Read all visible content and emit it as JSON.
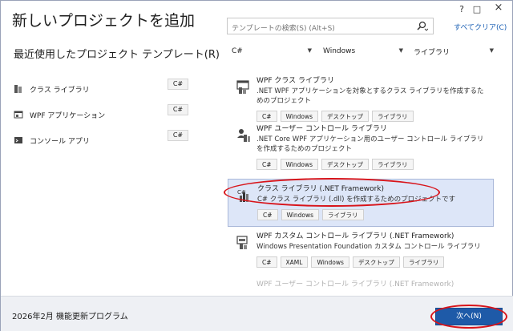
{
  "window": {
    "title": "新しいプロジェクトを追加",
    "help": "?",
    "close": "×",
    "maximize": "□"
  },
  "search": {
    "placeholder": "テンプレートの検索(S) (Alt+S)",
    "clear_all": "すべてクリア(C)"
  },
  "recent": {
    "title": "最近使用したプロジェクト テンプレート(R)",
    "items": [
      {
        "label": "クラス ライブラリ",
        "lang": "C#"
      },
      {
        "label": "WPF アプリケーション",
        "lang": "C#"
      },
      {
        "label": "コンソール アプリ",
        "lang": "C#"
      }
    ]
  },
  "filters": {
    "language": "C#",
    "platform": "Windows",
    "project_type": "ライブラリ"
  },
  "templates": [
    {
      "name": "WPF クラス ライブラリ",
      "desc": ".NET WPF アプリケーションを対象とするクラス ライブラリを作成するためのプロジェクト",
      "tags": [
        "C#",
        "Windows",
        "デスクトップ",
        "ライブラリ"
      ]
    },
    {
      "name": "WPF ユーザー コントロール ライブラリ",
      "desc": ".NET Core WPF アプリケーション用のユーザー コントロール ライブラリを作成するためのプロジェクト",
      "tags": [
        "C#",
        "Windows",
        "デスクトップ",
        "ライブラリ"
      ]
    },
    {
      "name": "クラス ライブラリ (.NET Framework)",
      "desc": "C# クラス ライブラリ (.dll) を作成するためのプロジェクトです",
      "tags": [
        "C#",
        "Windows",
        "ライブラリ"
      ]
    },
    {
      "name": "WPF カスタム コントロール ライブラリ (.NET Framework)",
      "desc": "Windows Presentation Foundation カスタム コントロール ライブラリ",
      "tags": [
        "C#",
        "XAML",
        "Windows",
        "デスクトップ",
        "ライブラリ"
      ]
    },
    {
      "name": "WPF ユーザー コントロール ライブラリ (.NET Framework)"
    }
  ],
  "footer": {
    "label": "2026年2月 機能更新プログラム",
    "next_button": "次へ(N)"
  },
  "colors": {
    "accent": "#1e5aa8",
    "selection": "#dde6f8",
    "highlight_ring": "#d8141a"
  }
}
